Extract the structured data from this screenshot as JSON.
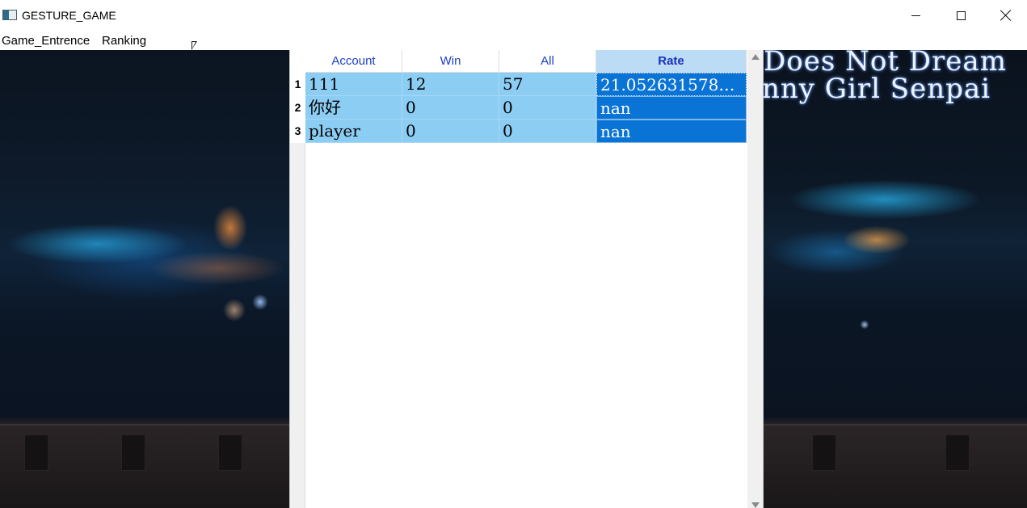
{
  "window": {
    "title": "GESTURE_GAME"
  },
  "menu": {
    "items": [
      "Game_Entrence",
      "Ranking"
    ]
  },
  "background": {
    "overlay_line1": "Does Not Dream",
    "overlay_line2": "nny Girl Senpai"
  },
  "table": {
    "columns": [
      "Account",
      "Win",
      "All",
      "Rate"
    ],
    "selected_column": "Rate",
    "row_headers": [
      "1",
      "2",
      "3"
    ],
    "rows": [
      [
        "111",
        "12",
        "57",
        "21.052631578…"
      ],
      [
        "你好",
        "0",
        "0",
        "nan"
      ],
      [
        "player",
        "0",
        "0",
        "nan"
      ]
    ]
  },
  "colors": {
    "row_highlight": "#8ccdf3",
    "selected_cell": "#0a74d6",
    "header_text": "#1a3fc8"
  }
}
